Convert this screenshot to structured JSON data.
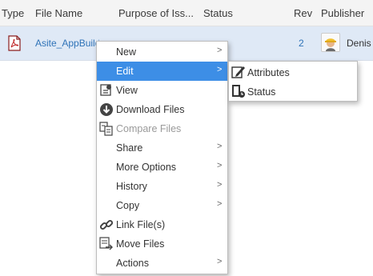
{
  "table": {
    "columns": {
      "type": "Type",
      "file_name": "File Name",
      "purpose": "Purpose of Iss...",
      "status": "Status",
      "rev": "Rev",
      "publisher": "Publisher"
    },
    "row": {
      "file_icon": "pdf-icon",
      "file_name": "Asite_AppBuild",
      "rev": "2",
      "publisher": "Denis",
      "publisher_avatar": "worker-avatar"
    }
  },
  "context_menu": {
    "items": [
      {
        "label": "New",
        "submenu": true
      },
      {
        "label": "Edit",
        "submenu": true,
        "active": true
      },
      {
        "label": "View",
        "icon": "view-icon"
      },
      {
        "label": "Download Files",
        "icon": "download-icon"
      },
      {
        "label": "Compare Files",
        "icon": "compare-icon",
        "disabled": true
      },
      {
        "label": "Share",
        "submenu": true
      },
      {
        "label": "More Options",
        "submenu": true
      },
      {
        "label": "History",
        "submenu": true
      },
      {
        "label": "Copy",
        "submenu": true
      },
      {
        "label": "Link File(s)",
        "icon": "link-icon"
      },
      {
        "label": "Move Files",
        "icon": "move-icon"
      },
      {
        "label": "Actions",
        "submenu": true
      }
    ],
    "arrow": ">"
  },
  "edit_submenu": {
    "items": [
      {
        "label": "Attributes",
        "icon": "edit-pencil-icon"
      },
      {
        "label": "Status",
        "icon": "status-icon"
      }
    ]
  },
  "colors": {
    "menu_highlight": "#3d8ee6",
    "row_selected": "#dfe9f6",
    "link": "#2f73b8"
  }
}
